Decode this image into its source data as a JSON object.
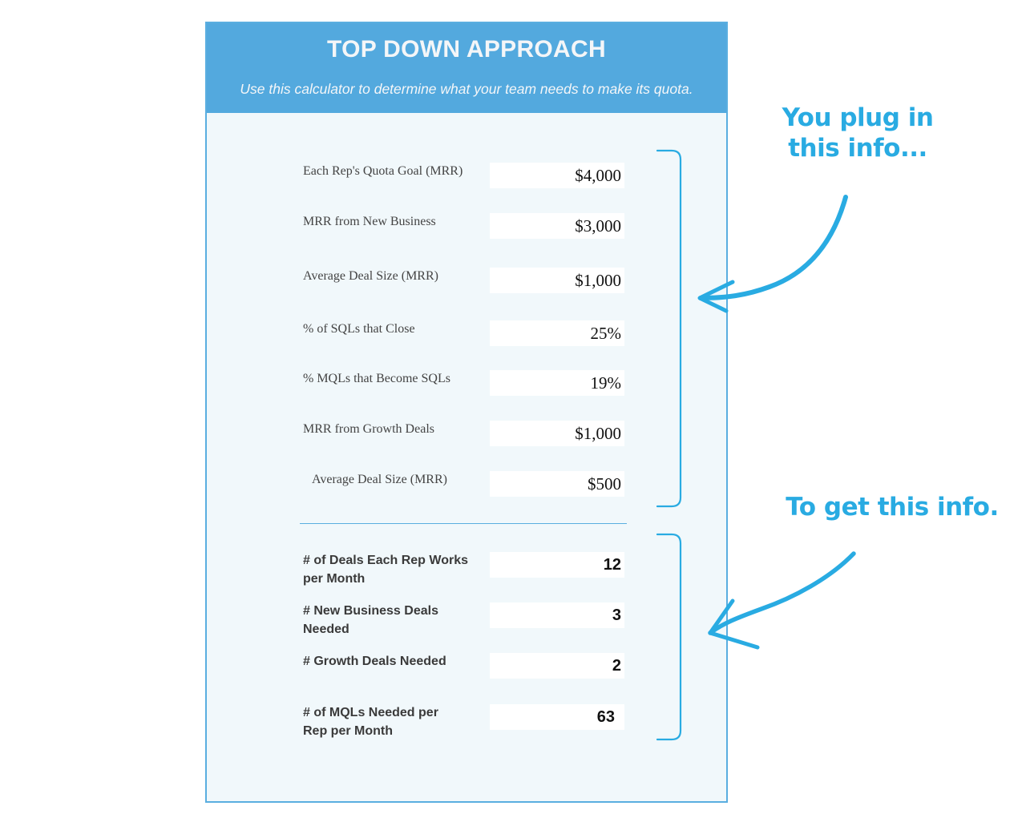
{
  "calculator": {
    "title": "TOP DOWN APPROACH",
    "subtitle": "Use this calculator to determine what your team needs to make its quota.",
    "inputs": [
      {
        "label": "Each Rep's Quota Goal (MRR)",
        "value": "$4,000"
      },
      {
        "label": "MRR from New Business",
        "value": "$3,000"
      },
      {
        "label": "Average Deal Size (MRR)",
        "value": "$1,000"
      },
      {
        "label": "% of SQLs that Close",
        "value": "25%"
      },
      {
        "label": "% MQLs that Become SQLs",
        "value": "19%"
      },
      {
        "label": "MRR from Growth Deals",
        "value": "$1,000"
      },
      {
        "label": "Average Deal Size (MRR)",
        "value": "$500"
      }
    ],
    "outputs": [
      {
        "label": "# of Deals Each Rep Works per Month",
        "value": "12"
      },
      {
        "label": "# New Business Deals Needed",
        "value": "3"
      },
      {
        "label": "# Growth Deals Needed",
        "value": "2"
      },
      {
        "label": "# of MQLs Needed per Rep per Month",
        "value": "63"
      }
    ]
  },
  "annotations": {
    "inputs_note": "You plug in this info...",
    "outputs_note": "To get this info."
  },
  "colors": {
    "header_blue": "#53a9de",
    "accent_cyan": "#29abe2",
    "panel_bg": "#f1f8fb"
  }
}
